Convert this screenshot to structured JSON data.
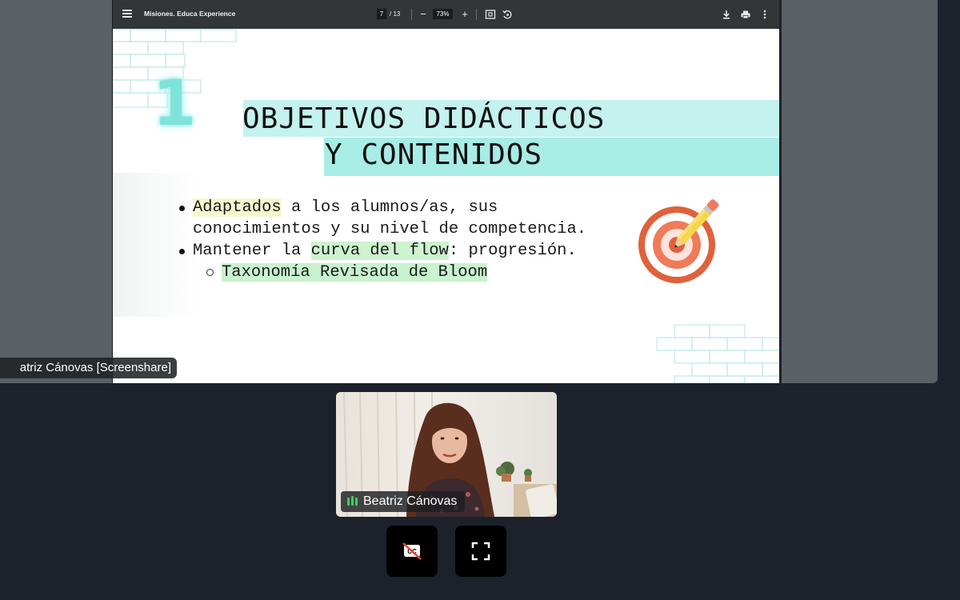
{
  "pdf_viewer": {
    "title": "Misiones. Educa Experience",
    "current_page": "7",
    "page_total": "/ 13",
    "zoom": "73%",
    "zoom_out_label": "−",
    "zoom_in_label": "+"
  },
  "slide": {
    "number": "1",
    "title_line1": "OBJETIVOS DIDÁCTICOS",
    "title_line2": "Y CONTENIDOS",
    "bullet1": {
      "highlight": "Adaptados",
      "rest": " a los alumnos/as, sus",
      "line2": "conocimientos y su nivel de competencia."
    },
    "bullet2": {
      "prefix": "Mantener la ",
      "highlight": "curva del flow",
      "suffix": ": progresión."
    },
    "sub_bullet": "Taxonomía Revisada de Bloom"
  },
  "screenshare_label": "atriz Cánovas [Screenshare]",
  "participant": {
    "name": "Beatriz Cánovas"
  },
  "controls": {
    "captions_icon": "captions-off-icon",
    "fullscreen_icon": "fullscreen-icon"
  },
  "colors": {
    "background": "#1c212b",
    "toolbar": "#323639",
    "title_band": "#a8ece6",
    "highlight_yellow": "#f6f8cf",
    "highlight_green": "#cdf3cf",
    "audio_active": "#3ecf60"
  }
}
